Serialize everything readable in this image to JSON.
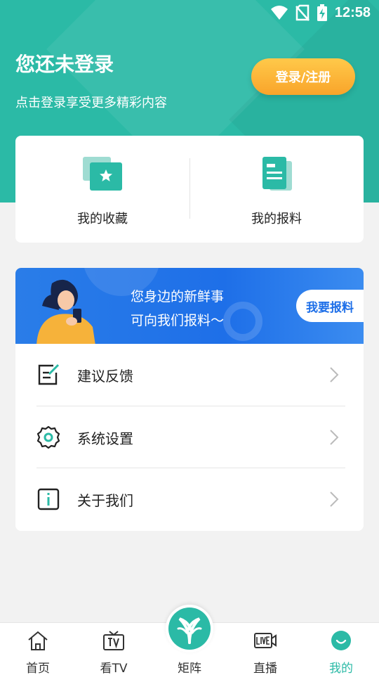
{
  "status_bar": {
    "time": "12:58"
  },
  "login": {
    "title": "您还未登录",
    "subtitle": "点击登录享受更多精彩内容",
    "button_label": "登录/注册"
  },
  "quick_actions": [
    {
      "label": "我的收藏",
      "icon": "favorites-star-icon"
    },
    {
      "label": "我的报料",
      "icon": "report-document-icon"
    }
  ],
  "banner": {
    "line1": "您身边的新鲜事",
    "line2": "可向我们报料～",
    "button_label": "我要报料"
  },
  "menu": [
    {
      "label": "建议反馈",
      "icon": "feedback-edit-icon"
    },
    {
      "label": "系统设置",
      "icon": "settings-gear-icon"
    },
    {
      "label": "关于我们",
      "icon": "info-icon"
    }
  ],
  "tabs": [
    {
      "label": "首页",
      "icon": "home-icon",
      "active": false
    },
    {
      "label": "看TV",
      "icon": "tv-icon",
      "active": false
    },
    {
      "label": "矩阵",
      "icon": "matrix-logo-icon",
      "active": false
    },
    {
      "label": "直播",
      "icon": "live-icon",
      "active": false
    },
    {
      "label": "我的",
      "icon": "profile-smile-icon",
      "active": true
    }
  ],
  "colors": {
    "brand": "#2bbaa6",
    "accent": "#f9a42a",
    "banner": "#1e6fe8"
  }
}
